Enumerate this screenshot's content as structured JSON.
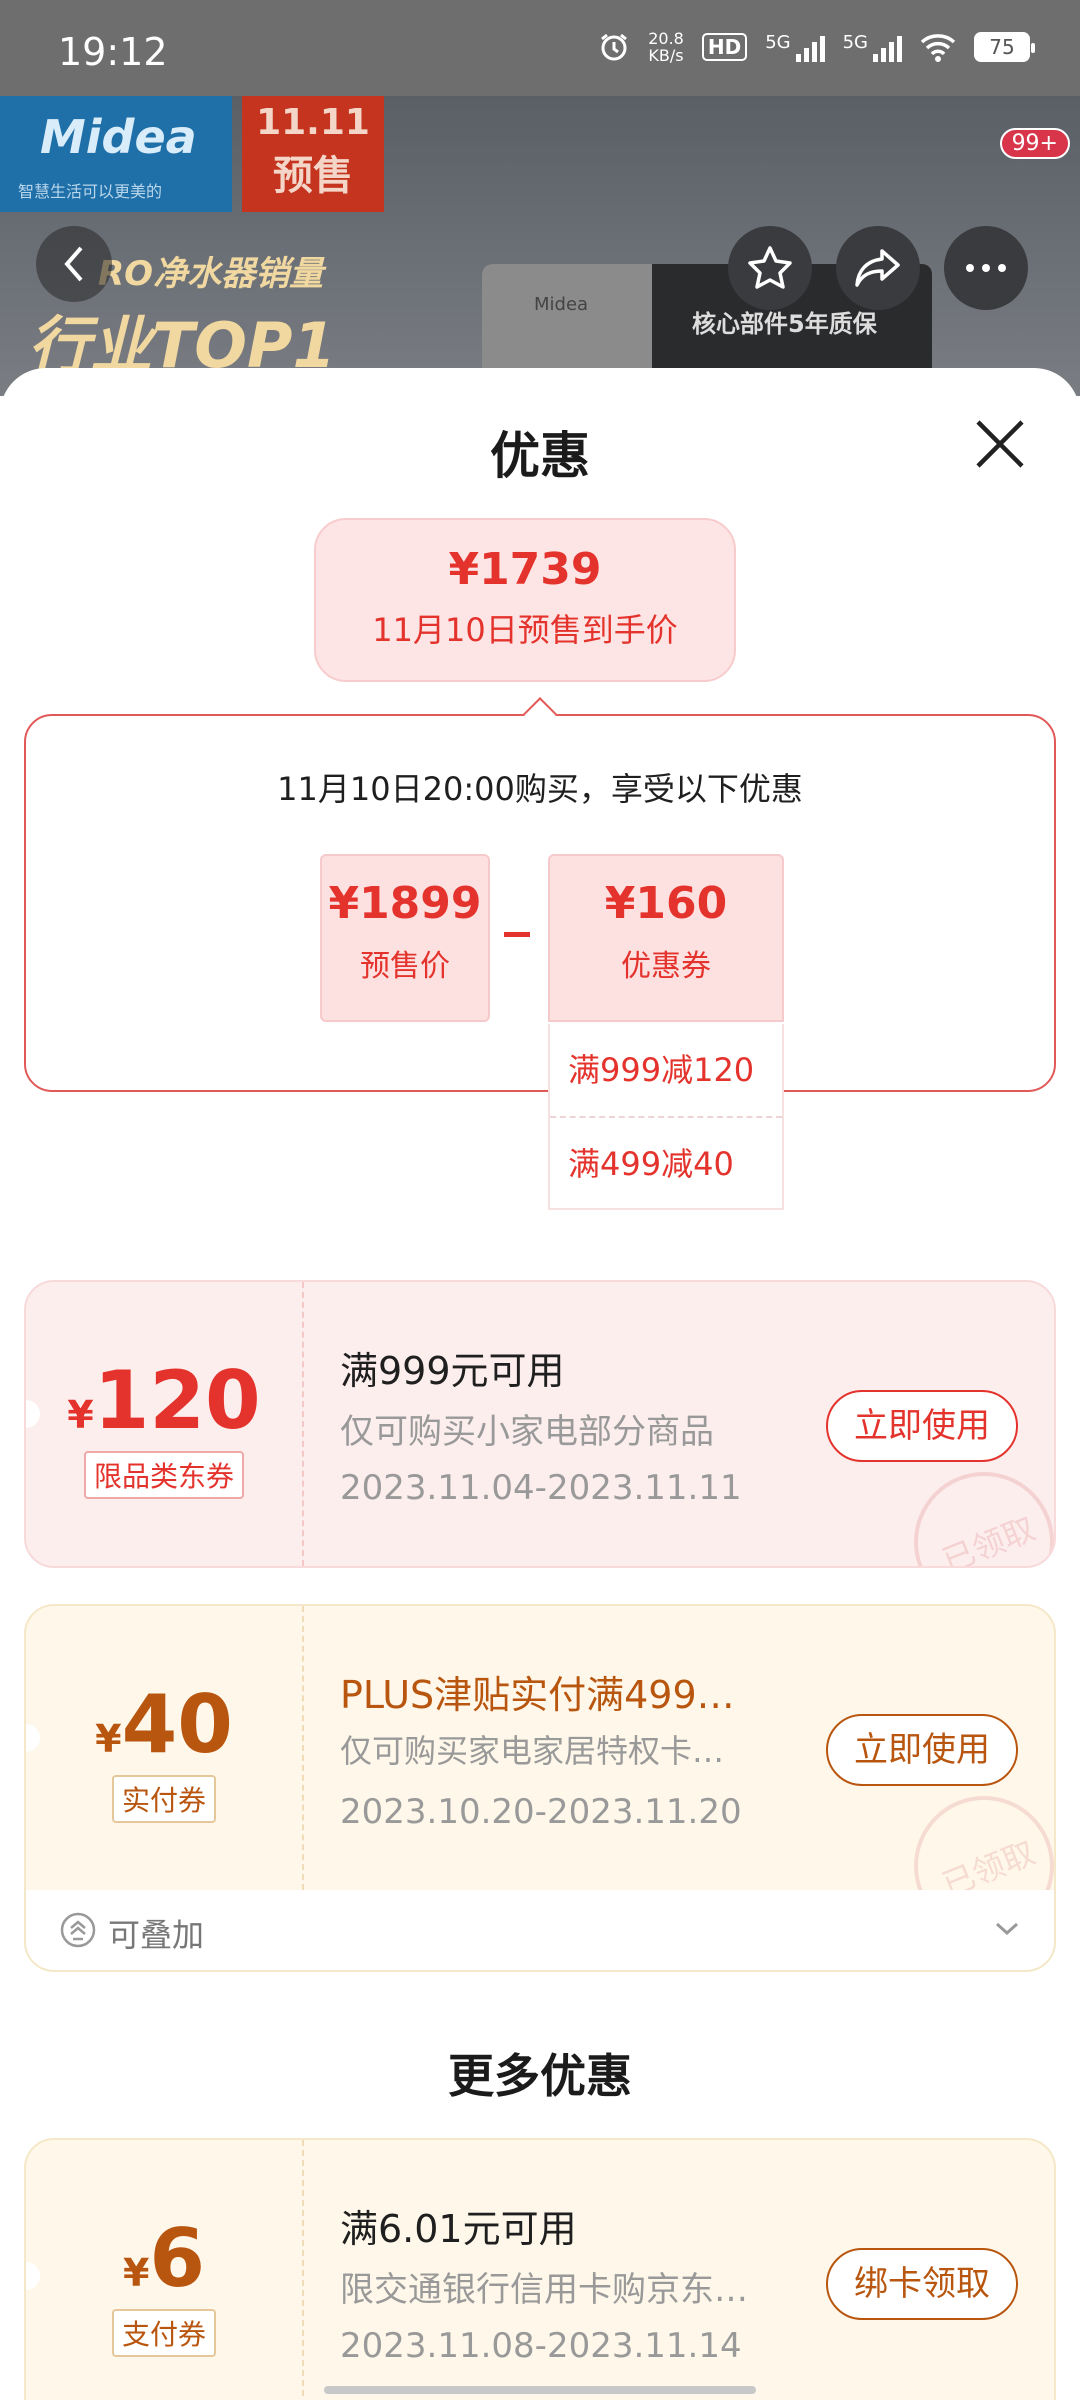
{
  "status_bar": {
    "time": "19:12",
    "net_speed_value": "20.8",
    "net_speed_unit": "KB/s",
    "hd_label": "HD",
    "signal1": "5G",
    "signal2": "5G",
    "battery": "75"
  },
  "hero": {
    "brand_logo": "Midea",
    "brand_slogan": "智慧生活可以更美的",
    "sale_line1": "11.11",
    "sale_line2": "预售",
    "rank_line1": "RO净水器销量",
    "rank_line2": "行业TOP1",
    "product_logo": "Midea",
    "product_text": "核心部件5年质保",
    "notification_badge": "99+"
  },
  "sheet": {
    "title": "优惠",
    "price_pill": {
      "price": "¥1739",
      "label": "11月10日预售到手价"
    },
    "calc": {
      "heading": "11月10日20:00购买，享受以下优惠",
      "presale_value": "¥1899",
      "presale_label": "预售价",
      "coupon_value": "¥160",
      "coupon_label": "优惠券",
      "sub_items": [
        "满999减120",
        "满499减40"
      ]
    },
    "coupons": [
      {
        "yen": "¥",
        "amount": "120",
        "tag": "限品类东券",
        "title": "满999元可用",
        "desc": "仅可购买小家电部分商品",
        "date": "2023.11.04-2023.11.11",
        "button": "立即使用",
        "stamp": "已领取"
      },
      {
        "yen": "¥",
        "amount": "40",
        "tag": "实付券",
        "title": "PLUS津贴实付满499…",
        "desc": "仅可购买家电家居特权卡…",
        "date": "2023.10.20-2023.11.20",
        "button": "立即使用",
        "stamp": "已领取"
      }
    ],
    "stackable_label": "可叠加",
    "more_title": "更多优惠",
    "more_coupons": [
      {
        "yen": "¥",
        "amount": "6",
        "tag": "支付券",
        "title": "满6.01元可用",
        "desc": "限交通银行信用卡购京东…",
        "date": "2023.11.08-2023.11.14",
        "button": "绑卡领取"
      }
    ]
  },
  "colors": {
    "red": "#e4332c",
    "pink_bg": "#fdeeee",
    "gold": "#b8560f",
    "cream_bg": "#fff8ea"
  }
}
